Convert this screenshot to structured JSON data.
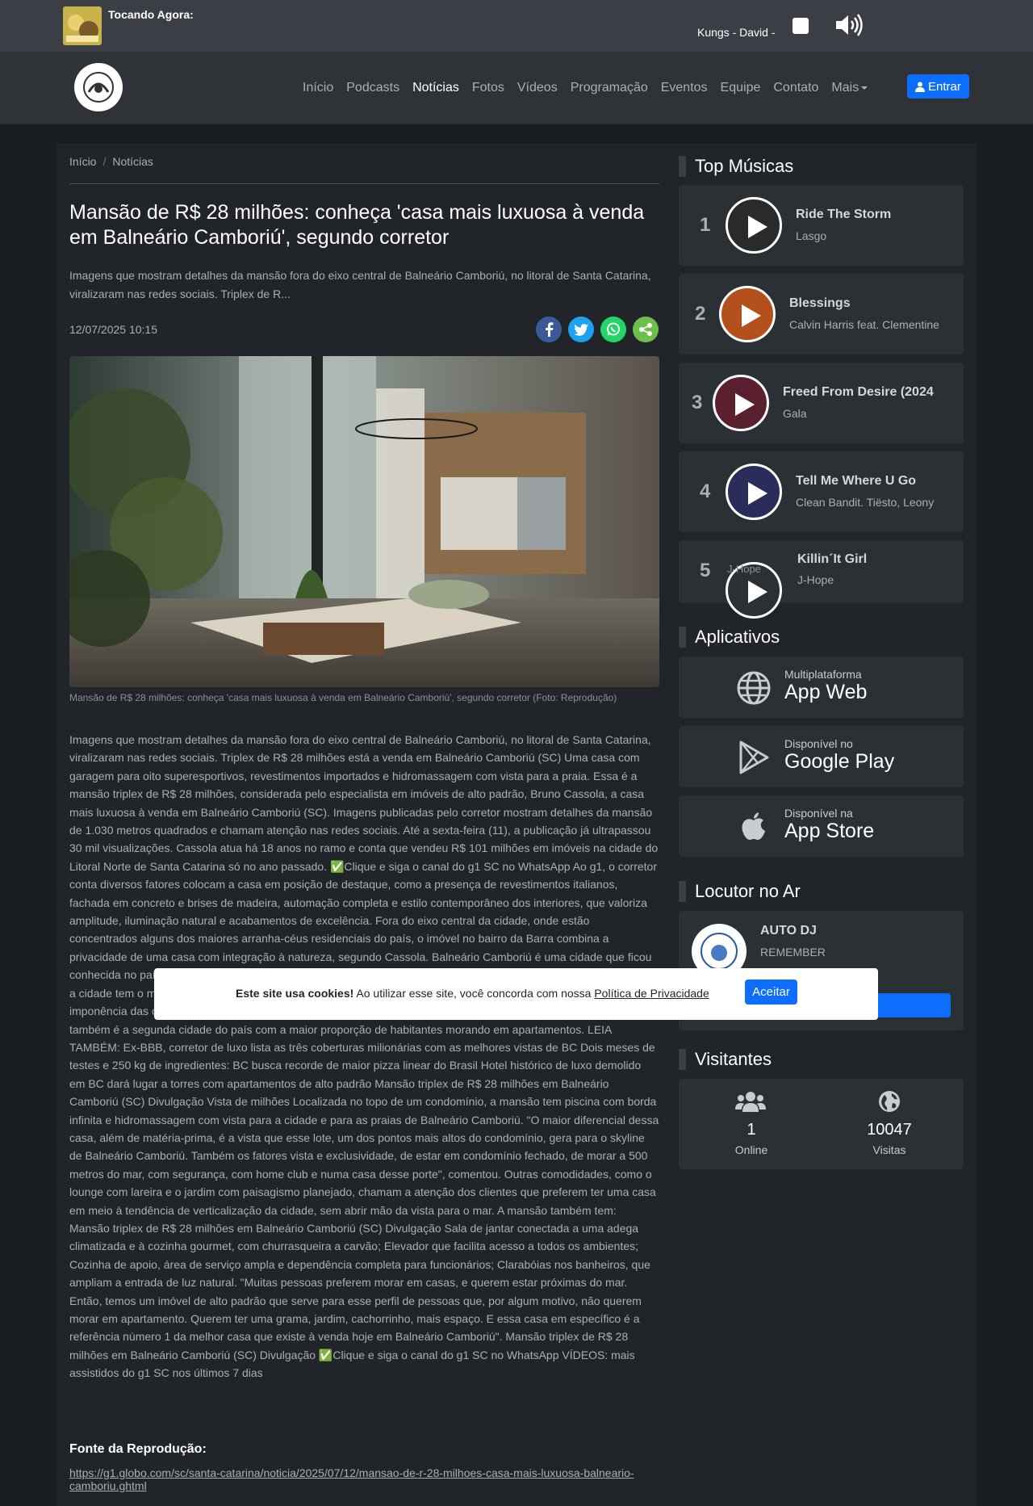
{
  "player": {
    "now_playing_label": "Tocando Agora:",
    "track_text": "Kungs - David -"
  },
  "nav": {
    "items": [
      "Início",
      "Podcasts",
      "Notícias",
      "Fotos",
      "Vídeos",
      "Programação",
      "Eventos",
      "Equipe",
      "Contato",
      "Mais"
    ],
    "active": "Notícias",
    "login_label": "Entrar"
  },
  "article": {
    "breadcrumb": [
      "Início",
      "Notícias"
    ],
    "title": "Mansão de R$ 28 milhões: conheça 'casa mais luxuosa à venda em Balneário Camboriú', segundo corretor",
    "lead": "Imagens que mostram detalhes da mansão fora do eixo central de Balneário Camboriú, no litoral de Santa Catarina, viralizaram nas redes sociais. Triplex de R...",
    "date": "12/07/2025 10:15",
    "caption": "Mansão de R$ 28 milhões: conheça 'casa mais luxuosa à venda em Balneário Camboriú', segundo corretor (Foto: Reprodução)",
    "body": "Imagens que mostram detalhes da mansão fora do eixo central de Balneário Camboriú, no litoral de Santa Catarina, viralizaram nas redes sociais. Triplex de R$ 28 milhões está a venda em Balneário Camboriú (SC) Uma casa com garagem para oito superesportivos, revestimentos importados e hidromassagem com vista para a praia. Essa é a mansão triplex de R$ 28 milhões, considerada pelo especialista em imóveis de alto padrão, Bruno Cassola, a casa mais luxuosa à venda em Balneário Camboriú (SC). Imagens publicadas pelo corretor mostram detalhes da mansão de 1.030 metros quadrados e chamam atenção nas redes sociais. Até a sexta-feira (11), a publicação já ultrapassou 30 mil visualizações. Cassola atua há 18 anos no ramo e conta que vendeu R$ 101 milhões em imóveis na cidade do Litoral Norte de Santa Catarina só no ano passado. ✅Clique e siga o canal do g1 SC no WhatsApp Ao g1, o corretor conta diversos fatores colocam a casa em posição de destaque, como a presença de revestimentos italianos, fachada em concreto e brises de madeira, automação completa e estilo contemporâneo dos interiores, que valoriza amplitude, iluminação natural e acabamentos de excelência. Fora do eixo central da cidade, onde estão concentrados alguns dos maiores arranha-céus residenciais do país, o imóvel no bairro da Barra combina a privacidade de uma casa com integração à natureza, segundo Cassola. Balneário Camboriú é uma cidade que ficou conhecida no país por uma megalópole vertical de prédios à beira-mar. Segundo levantamentos do setor imobiliário, a cidade tem o metro quadrado mais caro do Brasil. Conhecida como a \"Dubai brasileira\" pela verticalização e imponência das construções e por ter oito dos 10 arranha-céus residenciais mais altos do país, Balneário Camboriú também é a segunda cidade do país com a maior proporção de habitantes morando em apartamentos. LEIA TAMBÉM: Ex-BBB, corretor de luxo lista as três coberturas milionárias com as melhores vistas de BC Dois meses de testes e 250 kg de ingredientes: BC busca recorde de maior pizza linear do Brasil Hotel histórico de luxo demolido em BC dará lugar a torres com apartamentos de alto padrão Mansão triplex de R$ 28 milhões em Balneário Camboriú (SC) Divulgação Vista de milhões Localizada no topo de um condomínio, a mansão tem piscina com borda infinita e hidromassagem com vista para a cidade e para as praias de Balneário Camboriú. \"O maior diferencial dessa casa, além de matéria-prima, é a vista que esse lote, um dos pontos mais altos do condomínio, gera para o skyline de Balneário Camboriú. Também os fatores vista e exclusividade, de estar em condomínio fechado, de morar a 500 metros do mar, com segurança, com home club e numa casa desse porte\", comentou. Outras comodidades, como o lounge com lareira e o jardim com paisagismo planejado, chamam a atenção dos clientes que preferem ter uma casa em meio à tendência de verticalização da cidade, sem abrir mão da vista para o mar. A mansão também tem: Mansão triplex de R$ 28 milhões em Balneário Camboriú (SC) Divulgação Sala de jantar conectada a uma adega climatizada e à cozinha gourmet, com churrasqueira a carvão; Elevador que facilita acesso a todos os ambientes; Cozinha de apoio, área de serviço ampla e dependência completa para funcionários; Clarabóias nos banheiros, que ampliam a entrada de luz natural. \"Muitas pessoas preferem morar em casas, e querem estar próximas do mar. Então, temos um imóvel de alto padrão que serve para esse perfil de pessoas que, por algum motivo, não querem morar em apartamento. Querem ter uma grama, jardim, cachorrinho, mais espaço. E essa casa em específico é a referência número 1 da melhor casa que existe à venda hoje em Balneário Camboriú\". Mansão triplex de R$ 28 milhões em Balneário Camboriú (SC) Divulgação ✅Clique e siga o canal do g1 SC no WhatsApp VÍDEOS: mais assistidos do g1 SC nos últimos 7 dias",
    "source_title": "Fonte da Reprodução:",
    "source_url": "https://g1.globo.com/sc/santa-catarina/noticia/2025/07/12/mansao-de-r-28-milhoes-casa-mais-luxuosa-balneario-camboriu.ghtml"
  },
  "sidebar": {
    "top_title": "Top Músicas",
    "top": [
      {
        "rank": "1",
        "title": "Ride The Storm",
        "artist": "Lasgo",
        "color": "#2a2a2a"
      },
      {
        "rank": "2",
        "title": "Blessings",
        "artist": "Calvin Harris feat. Clementine",
        "color": "#b4501c"
      },
      {
        "rank": "3",
        "title": "Freed From Desire (2024 ",
        "artist": "Gala",
        "color": "#5a2030"
      },
      {
        "rank": "4",
        "title": "Tell Me Where U Go",
        "artist": "Clean Bandit. Tiësto, Leony",
        "color": "#2a2d5a"
      },
      {
        "rank": "5",
        "title": "Killin´It Girl",
        "artist": "J-Hope",
        "color": "#2b3035",
        "alt": "J-Hope"
      }
    ],
    "apps_title": "Aplicativos",
    "apps": [
      {
        "small": "Multiplataforma",
        "big": "App Web",
        "icon": "globe-icon"
      },
      {
        "small": "Disponível no",
        "big": "Google Play",
        "icon": "google-play-icon"
      },
      {
        "small": "Disponível na",
        "big": "App Store",
        "icon": "apple-icon"
      }
    ],
    "dj_title": "Locutor no Ar",
    "dj": {
      "name": "AUTO DJ",
      "program": "REMEMBER"
    },
    "visitors_title": "Visitantes",
    "visitors": {
      "online": "1",
      "online_label": "Online",
      "visits": "10047",
      "visits_label": "Visitas"
    }
  },
  "cookie": {
    "bold": "Este site usa cookies!",
    "text": " Ao utilizar esse site, você concorda com nossa ",
    "link": "Política de Privacidade",
    "button": "Aceitar"
  },
  "colors": {
    "accent": "#0d6efd",
    "facebook": "#3b5998",
    "twitter": "#1da1f2",
    "whatsapp": "#25d366",
    "share": "#6cc04a"
  }
}
